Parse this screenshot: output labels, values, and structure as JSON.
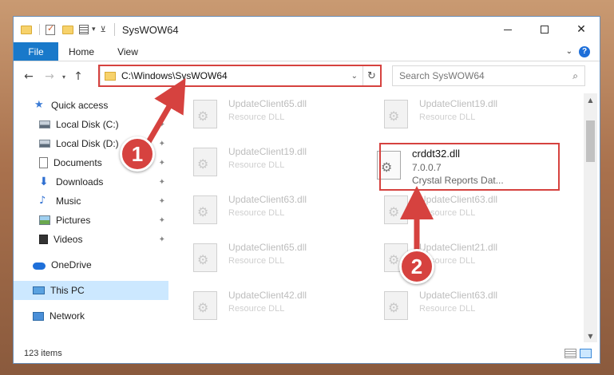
{
  "window": {
    "title": "SysWOW64",
    "controls": {
      "minimize": "",
      "maximize": "",
      "close": "✕"
    }
  },
  "ribbon": {
    "tabs": [
      "File",
      "Home",
      "View"
    ],
    "help": "?"
  },
  "nav": {
    "back": "←",
    "forward": "→",
    "recent": "▾",
    "up": "↑",
    "address": "C:\\Windows\\SysWOW64",
    "refresh": "↻",
    "search_placeholder": "Search SysWOW64",
    "search_icon": "⌕"
  },
  "sidebar": {
    "items": [
      {
        "label": "Quick access",
        "icon": "star-icon"
      },
      {
        "label": "Local Disk (C:)",
        "icon": "disk-icon",
        "pinned": true
      },
      {
        "label": "Local Disk (D:)",
        "icon": "disk-icon",
        "pinned": true
      },
      {
        "label": "Documents",
        "icon": "documents-icon",
        "pinned": true
      },
      {
        "label": "Downloads",
        "icon": "downloads-icon",
        "pinned": true
      },
      {
        "label": "Music",
        "icon": "music-icon",
        "pinned": true
      },
      {
        "label": "Pictures",
        "icon": "pictures-icon",
        "pinned": true
      },
      {
        "label": "Videos",
        "icon": "videos-icon",
        "pinned": true
      },
      {
        "label": "OneDrive",
        "icon": "onedrive-icon"
      },
      {
        "label": "This PC",
        "icon": "this-pc-icon",
        "selected": true
      },
      {
        "label": "Network",
        "icon": "network-icon"
      }
    ],
    "pin_glyph": "📌"
  },
  "files": {
    "left": [
      {
        "name": "UpdateClient65.dll",
        "type": "Resource DLL"
      },
      {
        "name": "UpdateClient19.dll",
        "type": "Resource DLL"
      },
      {
        "name": "UpdateClient63.dll",
        "type": "Resource DLL"
      },
      {
        "name": "UpdateClient65.dll",
        "type": "Resource DLL"
      },
      {
        "name": "UpdateClient42.dll",
        "type": "Resource DLL"
      }
    ],
    "right": [
      {
        "name": "UpdateClient19.dll",
        "type": "Resource DLL"
      },
      {
        "name": "UpdateClient63.dll",
        "type": "Resource DLL"
      },
      {
        "name": "UpdateClient21.dll",
        "type": "Resource DLL"
      },
      {
        "name": "UpdateClient63.dll",
        "type": "Resource DLL"
      }
    ],
    "highlighted": {
      "name": "crddt32.dll",
      "version": "7.0.0.7",
      "description": "Crystal Reports Dat..."
    }
  },
  "status": {
    "items": "123 items"
  },
  "annotations": {
    "badge1": "1",
    "badge2": "2",
    "color": "#d6423f"
  }
}
